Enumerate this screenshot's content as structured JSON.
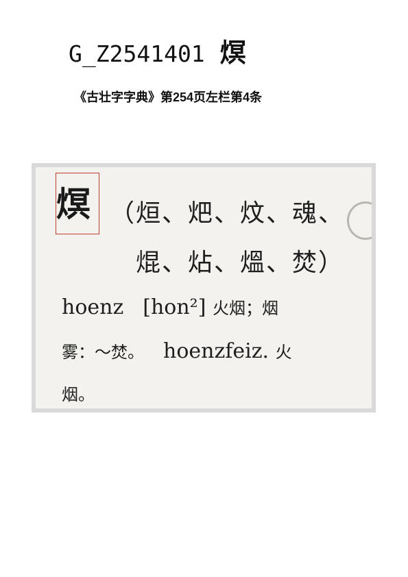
{
  "header": {
    "code": "G_Z2541401",
    "character": "熐"
  },
  "source": {
    "citation": "《古壮字字典》第254页左栏第4条"
  },
  "entry": {
    "headword": "熐",
    "variants_line1": "（烜、𤆵、炆、魂、",
    "variants_line2": "焜、炶、熅、焚）",
    "romanization": "hoenz",
    "phonetic": "[hon²]",
    "gloss1": "火烟；烟",
    "gloss2_prefix": "雾：～焚。",
    "compound": "hoenzfeiz.",
    "gloss2_suffix": "火",
    "gloss3": "烟。"
  }
}
